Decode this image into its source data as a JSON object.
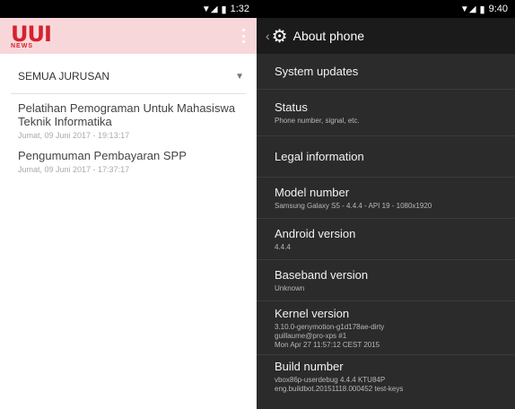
{
  "left_panel": {
    "status_time": "1:32",
    "logo_text": "UUI",
    "logo_sub": "NEWS",
    "dropdown_label": "SEMUA JURUSAN",
    "news": [
      {
        "title": "Pelatihan Pemograman Untuk Mahasiswa Teknik Informatika",
        "date": "Jumat, 09 Juni 2017 - 19:13:17"
      },
      {
        "title": "Pengumuman Pembayaran SPP",
        "date": "Jumat, 09 Juni 2017 - 17:37:17"
      }
    ]
  },
  "right_panel": {
    "status_time": "9:40",
    "title": "About phone",
    "settings": [
      {
        "title": "System updates",
        "subtitle": ""
      },
      {
        "title": "Status",
        "subtitle": "Phone number, signal, etc."
      },
      {
        "title": "Legal information",
        "subtitle": ""
      },
      {
        "title": "Model number",
        "subtitle": "Samsung Galaxy S5 - 4.4.4 - API 19 - 1080x1920"
      },
      {
        "title": "Android version",
        "subtitle": "4.4.4"
      },
      {
        "title": "Baseband version",
        "subtitle": "Unknown"
      },
      {
        "title": "Kernel version",
        "subtitle": "3.10.0-genymotion-g1d178ae-dirty\nguillaume@pro-xps #1\nMon Apr 27 11:57:12 CEST 2015"
      },
      {
        "title": "Build number",
        "subtitle": "vbox86p-userdebug 4.4.4 KTU84P\neng.buildbot.20151118.000452 test-keys"
      }
    ]
  }
}
